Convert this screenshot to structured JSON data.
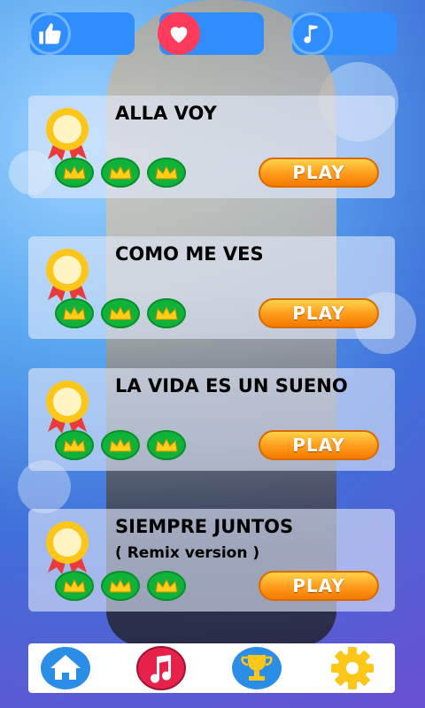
{
  "top_bar": [
    {
      "name": "like",
      "icon": "thumbs-up-icon",
      "color": "#2f8dff"
    },
    {
      "name": "favorites",
      "icon": "heart-icon",
      "color": "#ff3b5c"
    },
    {
      "name": "music",
      "icon": "music-note-icon",
      "color": "#2f8dff"
    }
  ],
  "songs": [
    {
      "title": "ALLA VOY",
      "subtitle": "",
      "crowns": 3,
      "play_label": "PLAY"
    },
    {
      "title": "COMO ME VES",
      "subtitle": "",
      "crowns": 3,
      "play_label": "PLAY"
    },
    {
      "title": "LA VIDA ES UN SUENO",
      "subtitle": "",
      "crowns": 3,
      "play_label": "PLAY"
    },
    {
      "title": "SIEMPRE JUNTOS",
      "subtitle": "( Remix version )",
      "crowns": 3,
      "play_label": "PLAY"
    }
  ],
  "bottom_nav": [
    {
      "name": "home",
      "icon": "home-icon"
    },
    {
      "name": "music",
      "icon": "music-app-icon"
    },
    {
      "name": "trophy",
      "icon": "trophy-icon"
    },
    {
      "name": "settings",
      "icon": "gear-icon"
    }
  ],
  "colors": {
    "play_orange": "#ff9a1a",
    "crown_green": "#0fb33a",
    "stat_blue": "#2f8dff"
  }
}
